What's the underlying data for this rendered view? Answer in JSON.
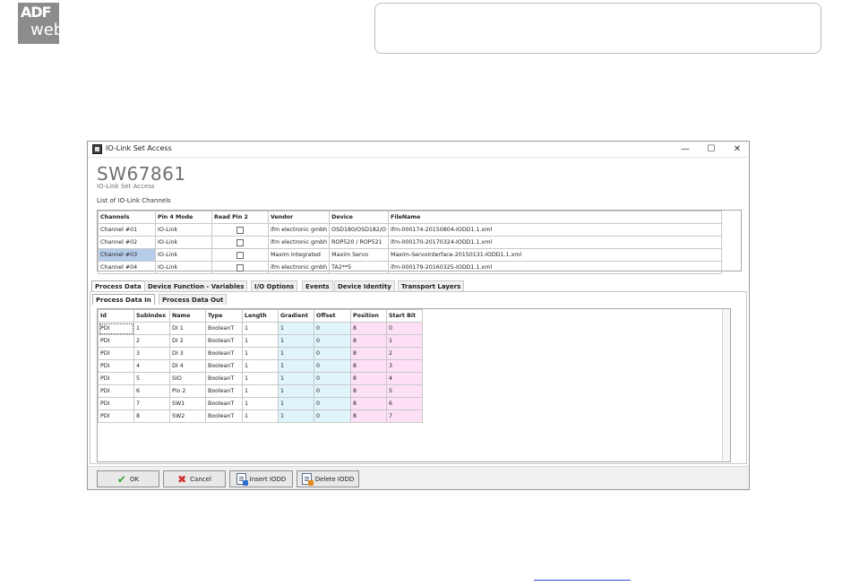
{
  "logo": {
    "line1": "ADF",
    "line2": "web"
  },
  "window": {
    "title": "IO-Link Set Access",
    "buttons": {
      "minimize": "—",
      "maximize": "☐",
      "close": "✕"
    }
  },
  "header": {
    "title": "SW67861",
    "subtitle": "IO-Link Set Access"
  },
  "channels": {
    "label": "List of IO-Link Channels",
    "columns": [
      "Channels",
      "Pin 4 Mode",
      "Read Pin 2",
      "Vendor",
      "Device",
      "FileName"
    ],
    "rows": [
      {
        "channel": "Channel #01",
        "mode": "IO-Link",
        "read_pin2": false,
        "vendor": "ifm electronic gmbh",
        "device": "OSD180/OSD182/O",
        "file": "ifm-000174-20150804-IODD1.1.xml"
      },
      {
        "channel": "Channel #02",
        "mode": "IO-Link",
        "read_pin2": false,
        "vendor": "ifm electronic gmbh",
        "device": "ROP520 / ROP521",
        "file": "ifm-000170-20170324-IODD1.1.xml"
      },
      {
        "channel": "Channel #03",
        "mode": "IO-Link",
        "read_pin2": false,
        "vendor": "Maxim Integrated",
        "device": "Maxim Servo",
        "file": "Maxim-ServoInterface-20150131-IODD1.1.xml"
      },
      {
        "channel": "Channel #04",
        "mode": "IO-Link",
        "read_pin2": false,
        "vendor": "ifm electronic gmbh",
        "device": "TA2**5",
        "file": "ifm-000179-20160325-IODD1.1.xml"
      }
    ]
  },
  "tabs": [
    "Process Data",
    "Device Function - Variables",
    "I/O Options",
    "Events",
    "Device Identity",
    "Transport Layers"
  ],
  "subtabs": [
    "Process Data In",
    "Process Data Out"
  ],
  "process_data": {
    "columns": [
      "Id",
      "SubIndex",
      "Name",
      "Type",
      "Length",
      "Gradient",
      "Offset",
      "Position",
      "Start Bit"
    ],
    "rows": [
      [
        "PDI",
        "1",
        "DI 1",
        "BooleanT",
        "1",
        "1",
        "0",
        "8",
        "0"
      ],
      [
        "PDI",
        "2",
        "DI 2",
        "BooleanT",
        "1",
        "1",
        "0",
        "8",
        "1"
      ],
      [
        "PDI",
        "3",
        "DI 3",
        "BooleanT",
        "1",
        "1",
        "0",
        "8",
        "2"
      ],
      [
        "PDI",
        "4",
        "DI 4",
        "BooleanT",
        "1",
        "1",
        "0",
        "8",
        "3"
      ],
      [
        "PDI",
        "5",
        "SIO",
        "BooleanT",
        "1",
        "1",
        "0",
        "8",
        "4"
      ],
      [
        "PDI",
        "6",
        "Pin 2",
        "BooleanT",
        "1",
        "1",
        "0",
        "8",
        "5"
      ],
      [
        "PDI",
        "7",
        "SW1",
        "BooleanT",
        "1",
        "1",
        "0",
        "8",
        "6"
      ],
      [
        "PDI",
        "8",
        "SW2",
        "BooleanT",
        "1",
        "1",
        "0",
        "8",
        "7"
      ]
    ]
  },
  "footer": {
    "ok": "OK",
    "cancel": "Cancel",
    "insert": "Insert IODD",
    "delete": "Delete IODD"
  },
  "colors": {
    "selected": "#b6cdea",
    "gradient_offset_bg": "#e0f4fc",
    "position_startbit_bg": "#fde0f5",
    "link": "#2a4fd6"
  }
}
